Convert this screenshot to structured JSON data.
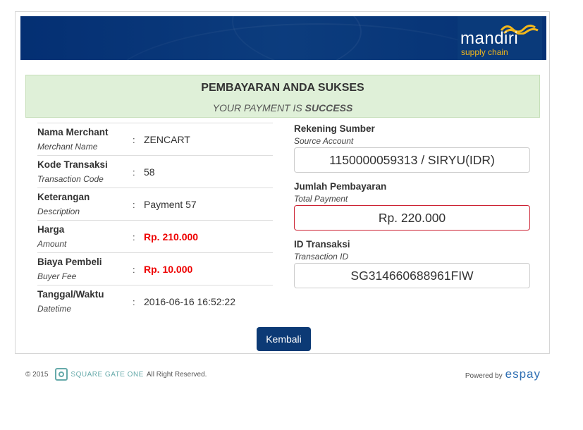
{
  "banner": {
    "brand": "mandiri",
    "subbrand": "supply chain"
  },
  "success": {
    "title": "PEMBAYARAN ANDA SUKSES",
    "subtitle_prefix": "YOUR PAYMENT IS",
    "subtitle_emphasis": "SUCCESS"
  },
  "details": [
    {
      "label": "Nama Merchant",
      "sublabel": "Merchant Name",
      "colon": ":",
      "value": "ZENCART",
      "highlight": false
    },
    {
      "label": "Kode Transaksi",
      "sublabel": "Transaction Code",
      "colon": ":",
      "value": "58",
      "highlight": false
    },
    {
      "label": "Keterangan",
      "sublabel": "Description",
      "colon": ":",
      "value": "Payment 57",
      "highlight": false
    },
    {
      "label": "Harga",
      "sublabel": "Amount",
      "colon": ":",
      "value": "Rp. 210.000",
      "highlight": true
    },
    {
      "label": "Biaya Pembeli",
      "sublabel": "Buyer Fee",
      "colon": ":",
      "value": "Rp. 10.000",
      "highlight": true
    },
    {
      "label": "Tanggal/Waktu",
      "sublabel": "Datetime",
      "colon": ":",
      "value": "2016-06-16 16:52:22",
      "highlight": false
    }
  ],
  "right": {
    "source": {
      "label": "Rekening Sumber",
      "sublabel": "Source Account",
      "value": "1150000059313 / SIRYU(IDR)"
    },
    "total": {
      "label": "Jumlah Pembayaran",
      "sublabel": "Total Payment",
      "value": "Rp. 220.000"
    },
    "txid": {
      "label": "ID Transaksi",
      "sublabel": "Transaction ID",
      "value": "SG314660688961FIW"
    }
  },
  "button": {
    "back_label": "Kembali"
  },
  "footer": {
    "copyright": "© 2015",
    "company": "SQUARE GATE ONE",
    "rights": "All Right Reserved.",
    "powered_by": "Powered by",
    "espay": "espay"
  },
  "colors": {
    "banner": "#0a3a7a",
    "accent_red": "#ee0000",
    "button": "#0c3a75",
    "success_bg": "#dff0d8"
  }
}
